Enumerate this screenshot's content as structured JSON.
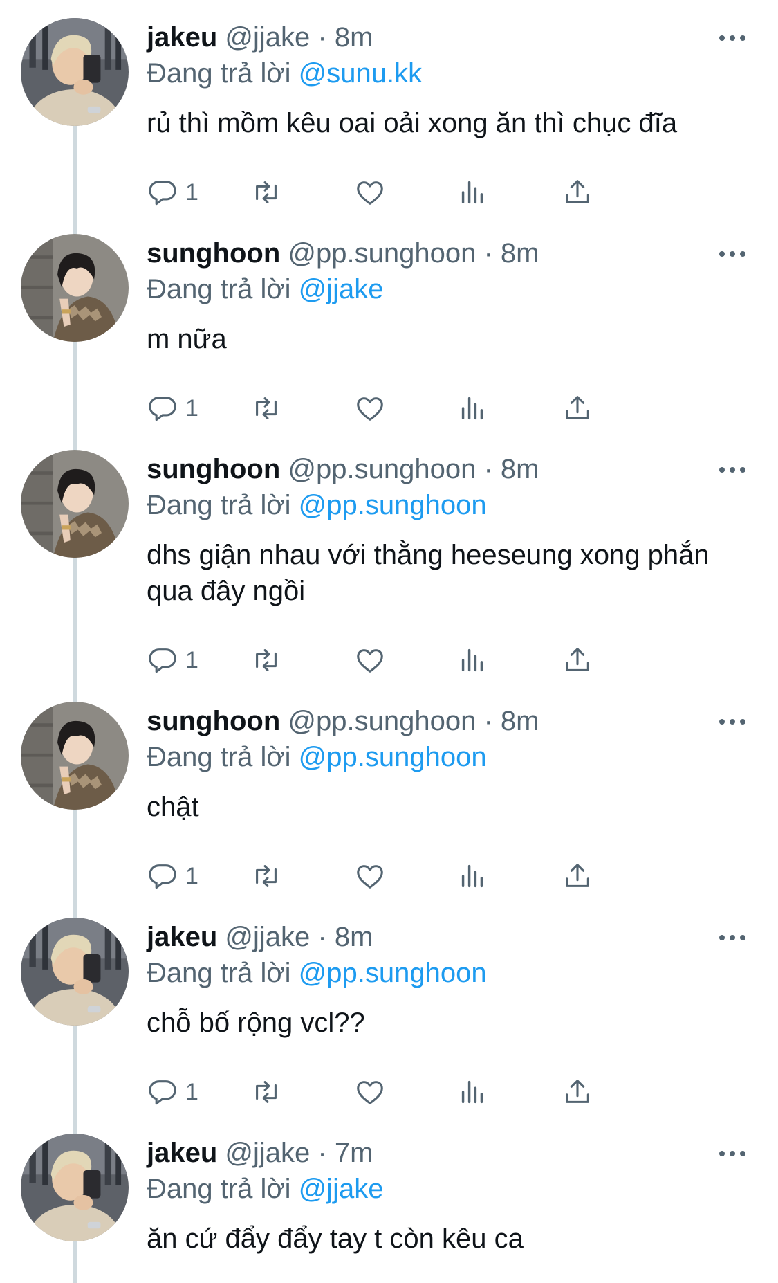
{
  "tweets": [
    {
      "display_name": "jakeu",
      "handle": "@jjake",
      "separator": "·",
      "time": "8m",
      "reply_prefix": "Đang trả lời",
      "reply_to": "@sunu.kk",
      "text": "rủ thì mồm kêu oai oải xong ăn thì chục đĩa",
      "reply_count": "1",
      "avatar": "jakeu"
    },
    {
      "display_name": "sunghoon",
      "handle": "@pp.sunghoon",
      "separator": "·",
      "time": "8m",
      "reply_prefix": "Đang trả lời",
      "reply_to": "@jjake",
      "text": "m nữa",
      "reply_count": "1",
      "avatar": "sunghoon"
    },
    {
      "display_name": "sunghoon",
      "handle": "@pp.sunghoon",
      "separator": "·",
      "time": "8m",
      "reply_prefix": "Đang trả lời",
      "reply_to": "@pp.sunghoon",
      "text": "dhs giận nhau với thằng heeseung xong phắn qua đây ngồi",
      "reply_count": "1",
      "avatar": "sunghoon"
    },
    {
      "display_name": "sunghoon",
      "handle": "@pp.sunghoon",
      "separator": "·",
      "time": "8m",
      "reply_prefix": "Đang trả lời",
      "reply_to": "@pp.sunghoon",
      "text": "chật",
      "reply_count": "1",
      "avatar": "sunghoon"
    },
    {
      "display_name": "jakeu",
      "handle": "@jjake",
      "separator": "·",
      "time": "8m",
      "reply_prefix": "Đang trả lời",
      "reply_to": "@pp.sunghoon",
      "text": "chỗ bố rộng vcl??",
      "reply_count": "1",
      "avatar": "jakeu"
    },
    {
      "display_name": "jakeu",
      "handle": "@jjake",
      "separator": "·",
      "time": "7m",
      "reply_prefix": "Đang trả lời",
      "reply_to": "@jjake",
      "text": "ăn cứ đẩy đẩy tay t còn kêu ca",
      "reply_count": "",
      "avatar": "jakeu"
    }
  ],
  "icons": {
    "reply": "reply-icon",
    "retweet": "retweet-icon",
    "like": "heart-icon",
    "views": "analytics-icon",
    "share": "share-icon",
    "more": "more-icon"
  },
  "colors": {
    "link": "#1d9bf0",
    "secondary_text": "#536471",
    "primary_text": "#0f1419",
    "thread_line": "#cfd9de"
  }
}
